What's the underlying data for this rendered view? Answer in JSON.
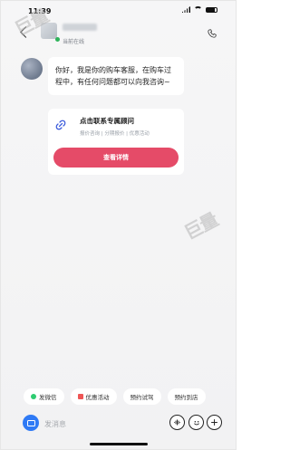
{
  "status_bar": {
    "time": "11:39"
  },
  "header": {
    "subtitle": "当前在线"
  },
  "chat": {
    "greeting": "你好，我是你的购车客服，在购车过程中，有任何问题都可以向我咨询~",
    "card": {
      "title": "点击联系专属顾问",
      "subtitle": "报价咨询 | 分期报价 | 优惠活动",
      "button_label": "查看详情"
    }
  },
  "quick_actions": [
    {
      "label": "发微信",
      "icon": "wechat-icon"
    },
    {
      "label": "优惠活动",
      "icon": "coupon-icon"
    },
    {
      "label": "预约试驾"
    },
    {
      "label": "预约到店"
    }
  ],
  "input": {
    "placeholder": "发消息"
  },
  "watermark": {
    "text": "巨量"
  },
  "colors": {
    "accent": "#E54B68",
    "camera": "#2F7AF5",
    "online": "#2EB35A"
  }
}
